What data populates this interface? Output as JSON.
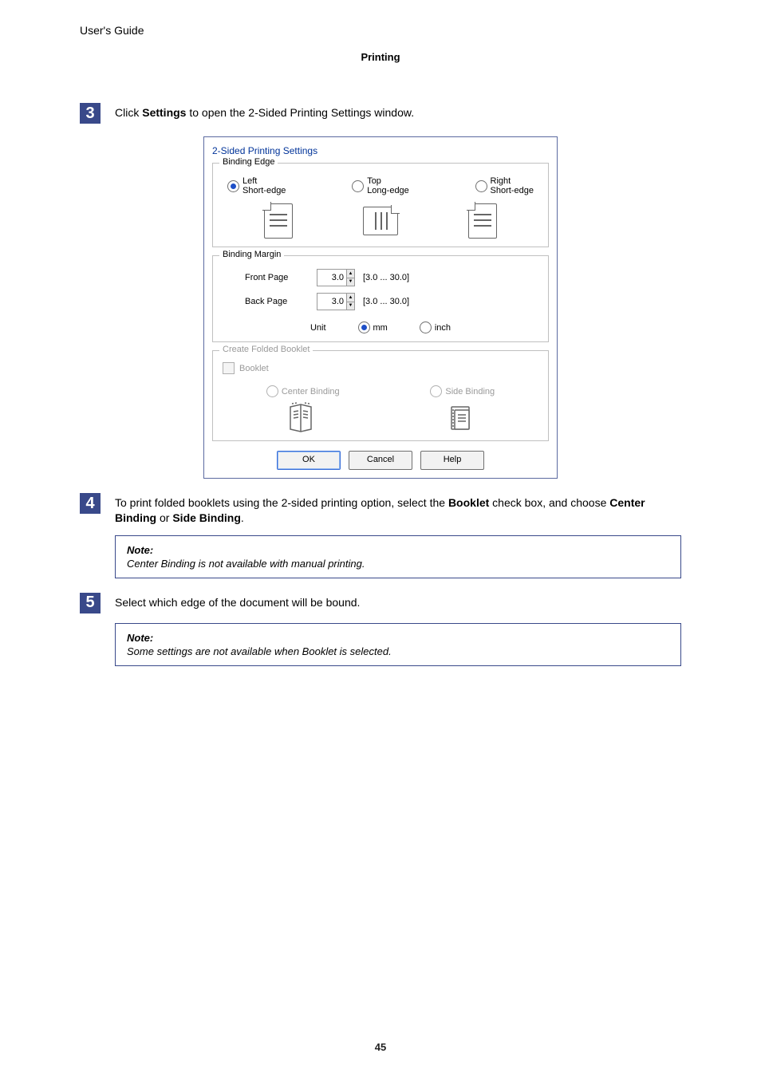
{
  "header_left": "User's Guide",
  "section": "Printing",
  "page_number": "45",
  "step3": {
    "num": "3",
    "pre": "Click ",
    "bold": "Settings",
    "post": " to open the 2-Sided Printing Settings window."
  },
  "step4": {
    "num": "4",
    "p1": "To print folded booklets using the 2-sided printing option, select the ",
    "b1": "Booklet",
    "p2": " check box, and choose ",
    "b2": "Center Binding",
    "p3": " or ",
    "b3": "Side Binding",
    "p4": "."
  },
  "step5": {
    "num": "5",
    "text": "Select which edge of the document will be bound."
  },
  "note1": {
    "title": "Note:",
    "body": "Center Binding is not available with manual printing."
  },
  "note2": {
    "title": "Note:",
    "body": "Some settings are not available when Booklet is selected."
  },
  "dialog": {
    "title": "2-Sided Printing Settings",
    "binding_edge": {
      "group": "Binding Edge",
      "left1": "Left",
      "left2": "Short-edge",
      "top1": "Top",
      "top2": "Long-edge",
      "right1": "Right",
      "right2": "Short-edge"
    },
    "binding_margin": {
      "group": "Binding Margin",
      "front": "Front Page",
      "back": "Back Page",
      "front_val": "3.0",
      "back_val": "3.0",
      "range": "[3.0 ... 30.0]",
      "unit_label": "Unit",
      "mm": "mm",
      "inch": "inch"
    },
    "folded": {
      "group": "Create Folded Booklet",
      "booklet": "Booklet",
      "center": "Center Binding",
      "side": "Side Binding"
    },
    "buttons": {
      "ok": "OK",
      "cancel": "Cancel",
      "help": "Help"
    }
  }
}
